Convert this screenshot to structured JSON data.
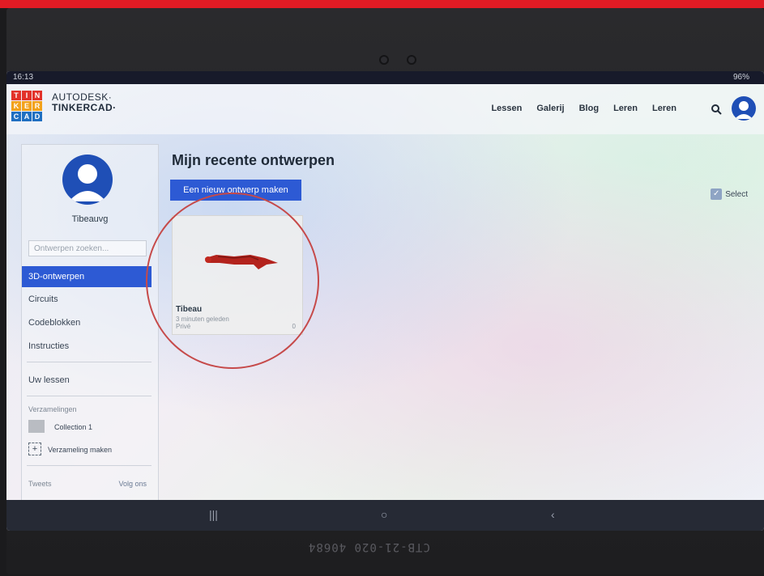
{
  "status_bar": {
    "time": "16:13",
    "battery": "96%"
  },
  "header": {
    "brand_line1": "AUTODESK·",
    "brand_line2": "TINKERCAD·",
    "nav": [
      "Lessen",
      "Galerij",
      "Blog",
      "Leren",
      "Leren"
    ]
  },
  "logo_letters": [
    "T",
    "I",
    "N",
    "K",
    "E",
    "R",
    "C",
    "A",
    "D"
  ],
  "sidebar": {
    "username": "Tibeauvg",
    "search_placeholder": "Ontwerpen zoeken...",
    "items": [
      "3D-ontwerpen",
      "Circuits",
      "Codeblokken",
      "Instructies"
    ],
    "lessons": "Uw lessen",
    "collections_label": "Verzamelingen",
    "collection_1": "Collection 1",
    "create_collection": "Verzameling maken",
    "tweets": "Tweets",
    "follow": "Volg ons"
  },
  "main": {
    "title": "Mijn recente ontwerpen",
    "new_button": "Een nieuw ontwerp maken",
    "select": "Select",
    "card": {
      "title": "Tibeau",
      "time": "3 minuten geleden",
      "privacy": "Privé",
      "count": "0"
    }
  },
  "device_label": "CTB-21-020 40684",
  "colors": {
    "accent": "#2d5ad4",
    "top_bar": "#e01b24",
    "annotation": "#c64a4a",
    "model": "#b3231d"
  }
}
